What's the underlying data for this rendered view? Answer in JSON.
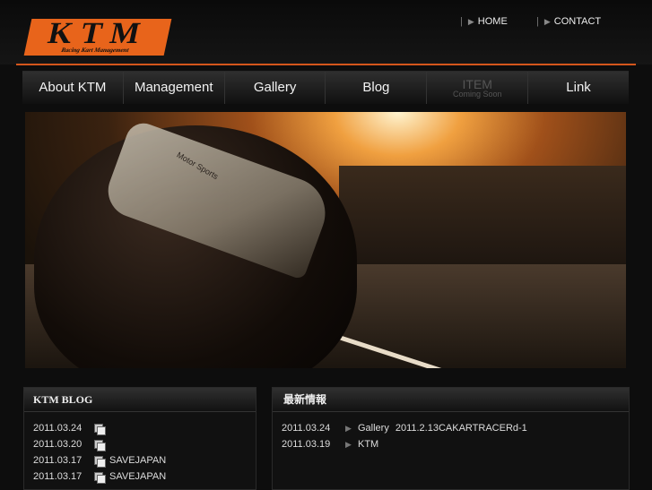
{
  "logo": {
    "main": "KTM",
    "sub": "Racing Kart Management"
  },
  "toplinks": [
    {
      "label": "HOME"
    },
    {
      "label": "CONTACT"
    }
  ],
  "nav": [
    {
      "label": "About KTM"
    },
    {
      "label": "Management"
    },
    {
      "label": "Gallery"
    },
    {
      "label": "Blog"
    },
    {
      "label": "ITEM",
      "sublabel": "Coming Soon"
    },
    {
      "label": "Link"
    }
  ],
  "hero": {
    "helmet_text": "Motor Sports"
  },
  "blog": {
    "title": "KTM BLOG",
    "entries": [
      {
        "date": "2011.03.24",
        "title": ""
      },
      {
        "date": "2011.03.20",
        "title": ""
      },
      {
        "date": "2011.03.17",
        "title": "SAVEJAPAN"
      },
      {
        "date": "2011.03.17",
        "title": "SAVEJAPAN"
      }
    ]
  },
  "news": {
    "title": "最新情報",
    "entries": [
      {
        "date": "2011.03.24",
        "category": "Gallery",
        "title": "2011.2.13CAKARTRACERd-1"
      },
      {
        "date": "2011.03.19",
        "category": "KTM",
        "title": ""
      }
    ]
  },
  "colors": {
    "accent": "#e8641b",
    "background": "#0d0d0d"
  }
}
